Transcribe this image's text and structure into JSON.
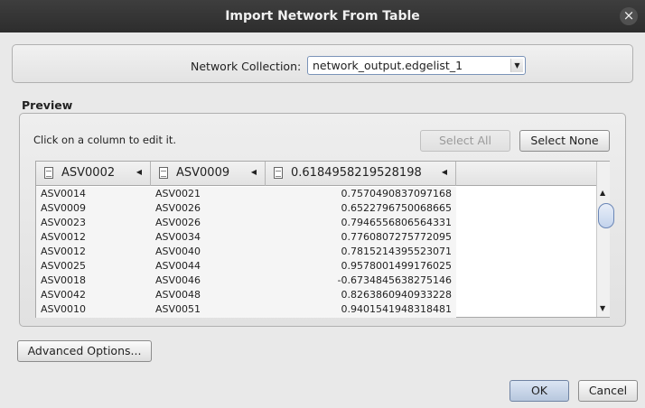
{
  "dialog": {
    "title": "Import Network From Table",
    "close_icon": "close-icon"
  },
  "collection": {
    "label": "Network Collection:",
    "selected": "network_output.edgelist_1"
  },
  "preview": {
    "section_label": "Preview",
    "hint": "Click on a column to edit it.",
    "select_all_label": "Select All",
    "select_none_label": "Select None",
    "columns": [
      "ASV0002",
      "ASV0009",
      "0.6184958219528198"
    ],
    "rows": [
      [
        "ASV0014",
        "ASV0021",
        "0.7570490837097168"
      ],
      [
        "ASV0009",
        "ASV0026",
        "0.6522796750068665"
      ],
      [
        "ASV0023",
        "ASV0026",
        "0.7946556806564331"
      ],
      [
        "ASV0012",
        "ASV0034",
        "0.7760807275772095"
      ],
      [
        "ASV0012",
        "ASV0040",
        "0.7815214395523071"
      ],
      [
        "ASV0025",
        "ASV0044",
        "0.9578001499176025"
      ],
      [
        "ASV0018",
        "ASV0046",
        "-0.6734845638275146"
      ],
      [
        "ASV0042",
        "ASV0048",
        "0.8263860940933228"
      ],
      [
        "ASV0010",
        "ASV0051",
        "0.9401541948318481"
      ]
    ]
  },
  "advanced_options_label": "Advanced Options...",
  "ok_label": "OK",
  "cancel_label": "Cancel"
}
